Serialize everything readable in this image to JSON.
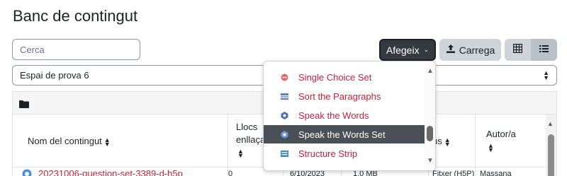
{
  "page": {
    "title": "Banc de contingut"
  },
  "search": {
    "placeholder": "Cerca"
  },
  "toolbar": {
    "add_label": "Afegeix",
    "upload_label": "Carrega",
    "grid_icon": "grid-icon",
    "list_icon": "list-icon"
  },
  "context": {
    "selected": "Espai de prova 6"
  },
  "table": {
    "headers": {
      "name": "Nom del contingut",
      "links_line1": "Llocs",
      "links_line2": "enllaça",
      "type": "us",
      "author": "Autor/a"
    },
    "row": {
      "name": "20231006-question-set-3389-d-h5p",
      "links": "0",
      "date": "6/10/2023",
      "size": "1.0 MB",
      "type": "Fitxer (H5P)",
      "author": "Massana"
    }
  },
  "dropdown": {
    "items": [
      {
        "label": "Single Choice Set",
        "icon": "single-choice-icon",
        "active": false
      },
      {
        "label": "Sort the Paragraphs",
        "icon": "sort-paragraphs-icon",
        "active": false
      },
      {
        "label": "Speak the Words",
        "icon": "speak-words-icon",
        "active": false
      },
      {
        "label": "Speak the Words Set",
        "icon": "speak-words-set-icon",
        "active": true
      },
      {
        "label": "Structure Strip",
        "icon": "structure-strip-icon",
        "active": false
      }
    ]
  },
  "colors": {
    "link_red": "#c91f37",
    "active_bg": "#495057",
    "add_button_bg": "#343a40"
  }
}
